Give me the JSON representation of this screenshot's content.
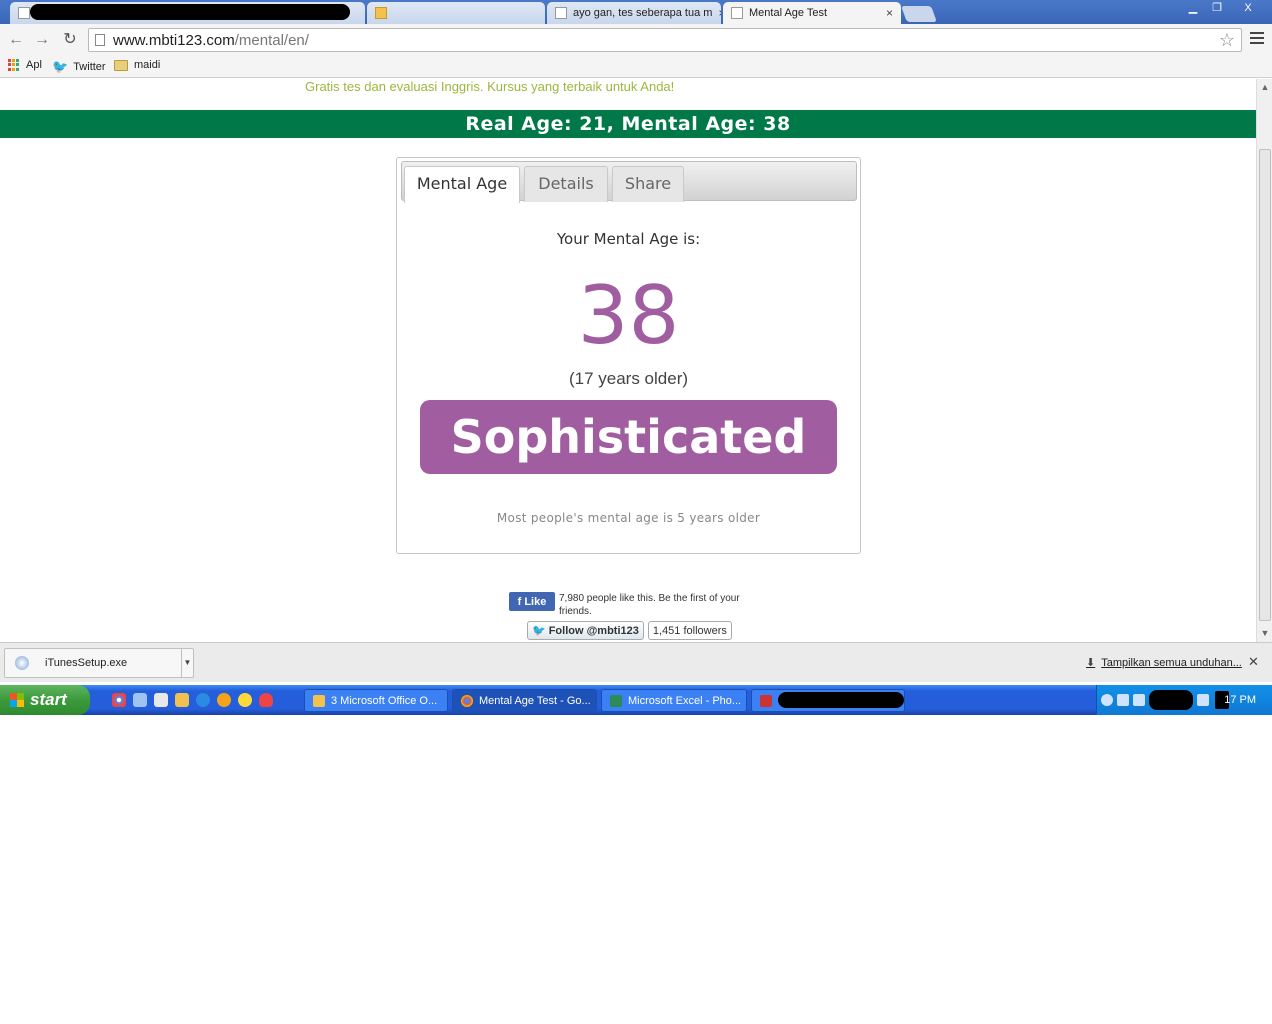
{
  "browser": {
    "tabs": [
      {
        "title": "",
        "redacted": true
      },
      {
        "title": "",
        "redacted": true
      },
      {
        "title": "ayo gan, tes seberapa tua m"
      },
      {
        "title": "Mental Age Test"
      }
    ],
    "address": {
      "host": "www.mbti123.com",
      "path": "/mental/en/"
    },
    "bookmarks": [
      {
        "label": "Apl",
        "icon": "apps-grid-icon"
      },
      {
        "label": "Twitter",
        "icon": "twitter-bird-icon"
      },
      {
        "label": "maidi",
        "icon": "folder-icon"
      }
    ],
    "window_controls": {
      "minimize": "▁",
      "restore": "❐",
      "close": "X"
    }
  },
  "page": {
    "promo_text": "Gratis tes dan evaluasi Inggris. Kursus yang terbaik untuk Anda!",
    "banner": "Real Age: 21, Mental Age: 38",
    "tabs": [
      "Mental Age",
      "Details",
      "Share"
    ],
    "active_tab": "Mental Age",
    "lead": "Your Mental Age is:",
    "mental_age": "38",
    "difference": "(17 years older)",
    "label": "Sophisticated",
    "note": "Most people's mental age is 5 years older",
    "accent_color": "#a05ea0",
    "banner_color": "#007847"
  },
  "social": {
    "fb_like": "Like",
    "fb_text": "7,980 people like this. Be the first of your friends.",
    "tw_follow": "Follow @mbti123",
    "tw_count": "1,451 followers"
  },
  "downloads": {
    "item": "iTunesSetup.exe",
    "show_all": "Tampilkan semua unduhan..."
  },
  "taskbar": {
    "start": "start",
    "tasks": [
      "3 Microsoft Office O...",
      "Mental Age Test - Go...",
      "Microsoft Excel - Pho..."
    ],
    "active_task": "Mental Age Test - Go...",
    "clock": "17 PM"
  }
}
